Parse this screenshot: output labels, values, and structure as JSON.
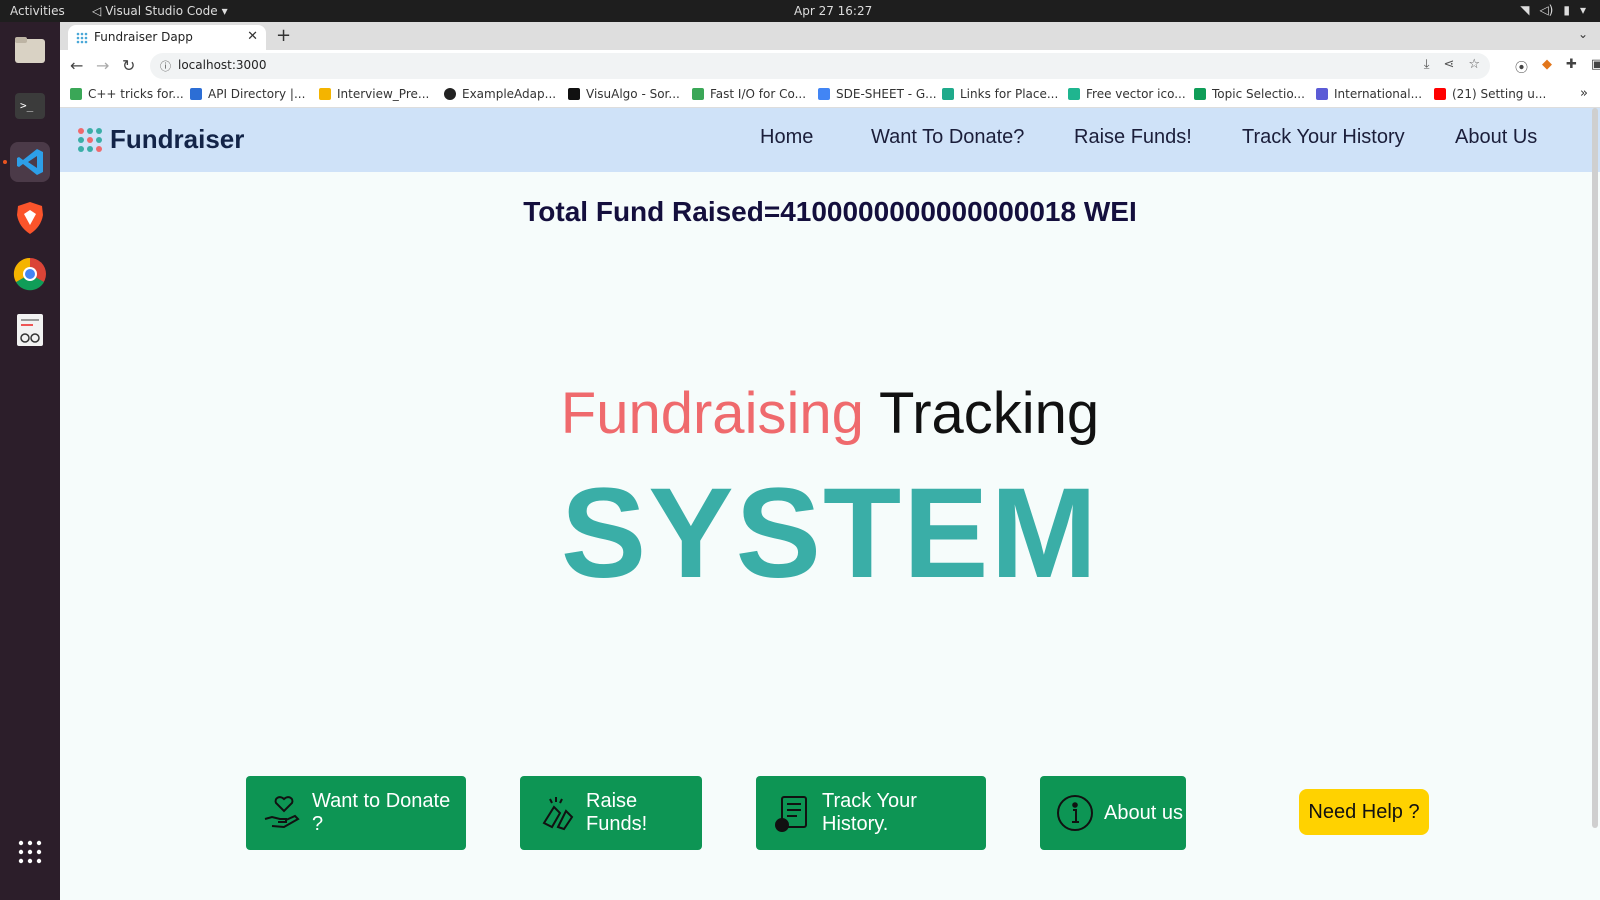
{
  "os": {
    "activities": "Activities",
    "app_name": "Visual Studio Code",
    "clock": "Apr 27  16:27"
  },
  "browser": {
    "tab_title": "Fundraiser Dapp",
    "url": "localhost:3000",
    "bookmarks": [
      {
        "label": "C++ tricks for...",
        "color": "#3aa757"
      },
      {
        "label": "API Directory |...",
        "color": "#2c6ed5"
      },
      {
        "label": "Interview_Pre...",
        "color": "#f4b400"
      },
      {
        "label": "ExampleAdap...",
        "color": "#222222"
      },
      {
        "label": "VisuAlgo - Sor...",
        "color": "#111111"
      },
      {
        "label": "Fast I/O for Co...",
        "color": "#3aa757"
      },
      {
        "label": "SDE-SHEET - G...",
        "color": "#4285f4"
      },
      {
        "label": "Links for Place...",
        "color": "#1faa8b"
      },
      {
        "label": "Free vector ico...",
        "color": "#1fb58f"
      },
      {
        "label": "Topic Selectio...",
        "color": "#0f9d58"
      },
      {
        "label": "International...",
        "color": "#5b5bd6"
      },
      {
        "label": "(21) Setting u...",
        "color": "#ff0000"
      }
    ]
  },
  "page": {
    "brand": "Fundraiser",
    "nav": [
      "Home",
      "Want To Donate?",
      "Raise Funds!",
      "Track Your History",
      "About Us"
    ],
    "total_fund": "Total Fund Raised=4100000000000000018 WEI",
    "hero_word1": "Fundraising",
    "hero_word2": "Tracking",
    "hero_big": "SYSTEM",
    "buttons": {
      "donate": "Want to Donate ?",
      "raise": "Raise Funds!",
      "track": "Track Your History.",
      "about": "About us"
    },
    "help": "Need Help ?"
  },
  "colors": {
    "navbar_bg": "#cfe2f8",
    "page_bg": "#f6fcfb",
    "hero_accent": "#ef6a6d",
    "system_teal": "#3aaea7",
    "cta_green": "#0d9554",
    "help_yellow": "#ffd200"
  }
}
